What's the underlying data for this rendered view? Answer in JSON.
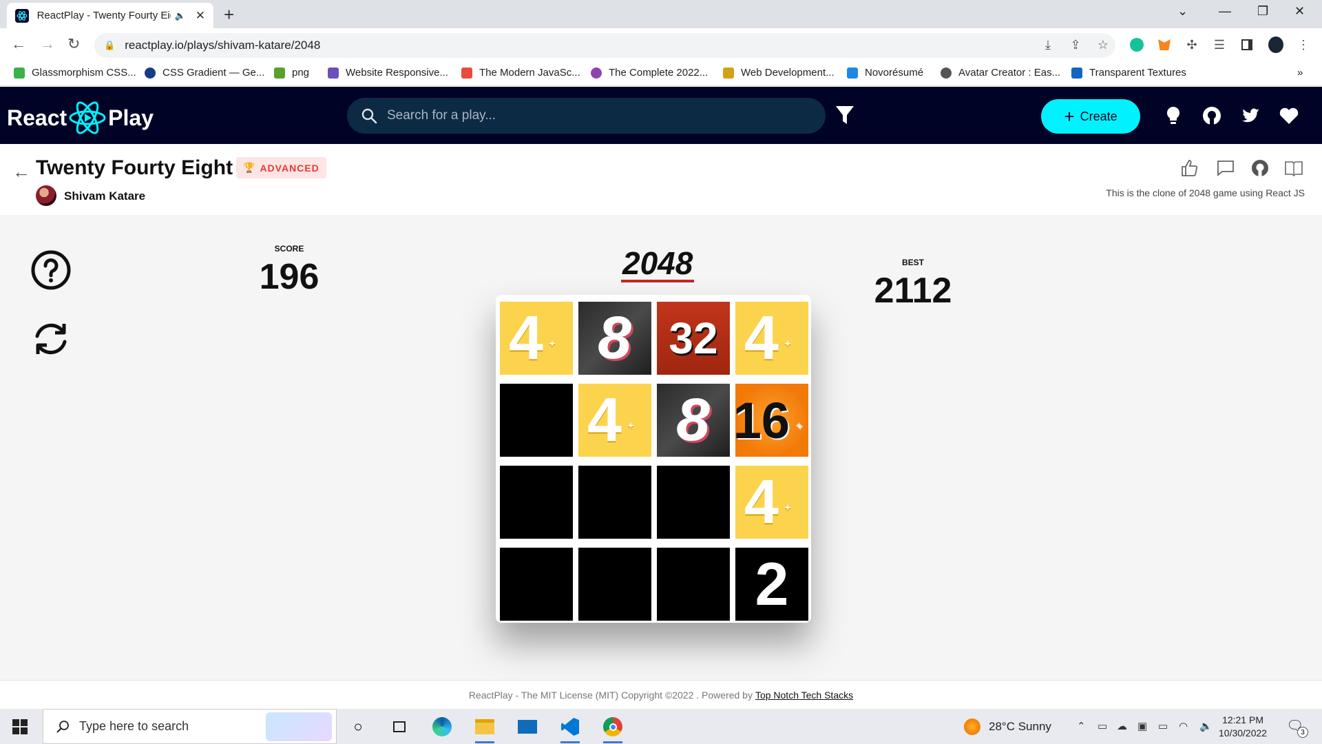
{
  "browser": {
    "tab_title": "ReactPlay - Twenty Fourty Eig",
    "url": "reactplay.io/plays/shivam-katare/2048",
    "bookmarks": [
      {
        "label": "Glassmorphism CSS...",
        "color": "#3bb14a"
      },
      {
        "label": "CSS Gradient — Ge...",
        "color": "#1a3a8a"
      },
      {
        "label": "png",
        "color": "#5aa02c"
      },
      {
        "label": "Website Responsive...",
        "color": "#6b4fbb"
      },
      {
        "label": "The Modern JavaSc...",
        "color": "#e74c3c"
      },
      {
        "label": "The Complete 2022...",
        "color": "#8e44ad"
      },
      {
        "label": "Web Development...",
        "color": "#d4a017"
      },
      {
        "label": "Novorésumé",
        "color": "#1e88e5"
      },
      {
        "label": "Avatar Creator : Eas...",
        "color": "#555555"
      },
      {
        "label": "Transparent Textures",
        "color": "#1565c0"
      }
    ],
    "more_bookmarks": "»"
  },
  "site": {
    "logo_left": "React",
    "logo_right": "Play",
    "search_placeholder": "Search for a play...",
    "create_label": "Create",
    "accent": "#00f2fe",
    "header_bg": "#010326"
  },
  "play": {
    "title": "Twenty Fourty Eight",
    "level": "ADVANCED",
    "author": "Shivam Katare",
    "description": "This is the clone of 2048 game using React JS"
  },
  "game": {
    "title": "2048",
    "score_label": "SCORE",
    "score": "196",
    "best_label": "BEST",
    "best": "2112",
    "board": [
      [
        4,
        8,
        32,
        4
      ],
      [
        0,
        4,
        8,
        16
      ],
      [
        0,
        0,
        0,
        4
      ],
      [
        0,
        0,
        0,
        2
      ]
    ]
  },
  "footer": {
    "text": "ReactPlay - The MIT License (MIT) Copyright ©2022 . Powered by",
    "link": "Top Notch Tech Stacks"
  },
  "taskbar": {
    "search_placeholder": "Type here to search",
    "weather": "28°C  Sunny",
    "time": "12:21 PM",
    "date": "10/30/2022",
    "notification_count": "3"
  }
}
